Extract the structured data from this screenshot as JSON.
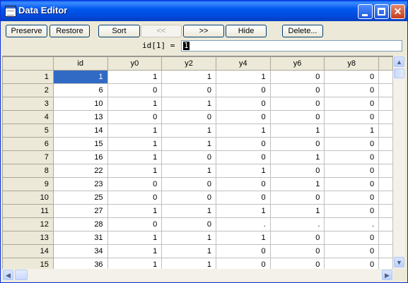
{
  "window": {
    "title": "Data Editor"
  },
  "toolbar": {
    "preserve": "Preserve",
    "restore": "Restore",
    "sort": "Sort",
    "back": "<<",
    "forward": ">>",
    "hide": "Hide",
    "delete": "Delete..."
  },
  "editbar": {
    "label": "id[1] =",
    "value": "1"
  },
  "grid": {
    "columns": [
      "id",
      "y0",
      "y2",
      "y4",
      "y6",
      "y8"
    ],
    "rows": [
      [
        "1",
        "1",
        "1",
        "1",
        "0",
        "0"
      ],
      [
        "6",
        "0",
        "0",
        "0",
        "0",
        "0"
      ],
      [
        "10",
        "1",
        "1",
        "0",
        "0",
        "0"
      ],
      [
        "13",
        "0",
        "0",
        "0",
        "0",
        "0"
      ],
      [
        "14",
        "1",
        "1",
        "1",
        "1",
        "1"
      ],
      [
        "15",
        "1",
        "1",
        "0",
        "0",
        "0"
      ],
      [
        "16",
        "1",
        "0",
        "0",
        "1",
        "0"
      ],
      [
        "22",
        "1",
        "1",
        "1",
        "0",
        "0"
      ],
      [
        "23",
        "0",
        "0",
        "0",
        "1",
        "0"
      ],
      [
        "25",
        "0",
        "0",
        "0",
        "0",
        "0"
      ],
      [
        "27",
        "1",
        "1",
        "1",
        "1",
        "0"
      ],
      [
        "28",
        "0",
        "0",
        ".",
        ".",
        "."
      ],
      [
        "31",
        "1",
        "1",
        "1",
        "0",
        "0"
      ],
      [
        "34",
        "1",
        "1",
        "0",
        "0",
        "0"
      ],
      [
        "36",
        "1",
        "1",
        "0",
        "0",
        "0"
      ]
    ]
  }
}
